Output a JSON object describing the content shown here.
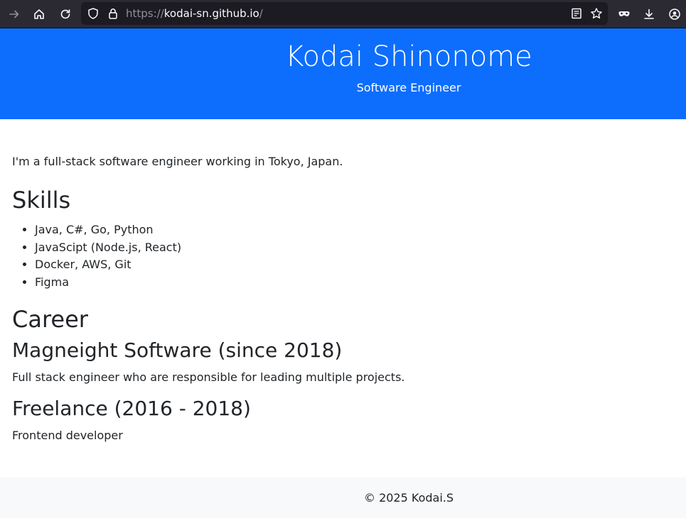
{
  "browser": {
    "url_scheme": "https://",
    "url_host": "kodai-sn.github.io",
    "url_path": "/",
    "icons": [
      "forward-icon",
      "home-icon",
      "reload-icon",
      "shield-icon",
      "lock-icon",
      "reader-view-icon",
      "bookmark-star-icon",
      "private-mask-icon",
      "downloads-icon",
      "account-icon"
    ]
  },
  "header": {
    "title": "Kodai Shinonome",
    "subtitle": "Software Engineer",
    "background": "#0d6efd"
  },
  "main": {
    "intro": "I'm a full-stack software engineer working in Tokyo, Japan.",
    "skills": {
      "heading": "Skills",
      "items": [
        "Java, C#, Go, Python",
        "JavaScipt (Node.js, React)",
        "Docker, AWS, Git",
        "Figma"
      ]
    },
    "career": {
      "heading": "Career",
      "entries": [
        {
          "title": "Magneight Software (since 2018)",
          "description": "Full stack engineer who are responsible for leading multiple projects."
        },
        {
          "title": "Freelance (2016 - 2018)",
          "description": "Frontend developer"
        }
      ]
    }
  },
  "footer": {
    "text": "© 2025 Kodai.S"
  }
}
